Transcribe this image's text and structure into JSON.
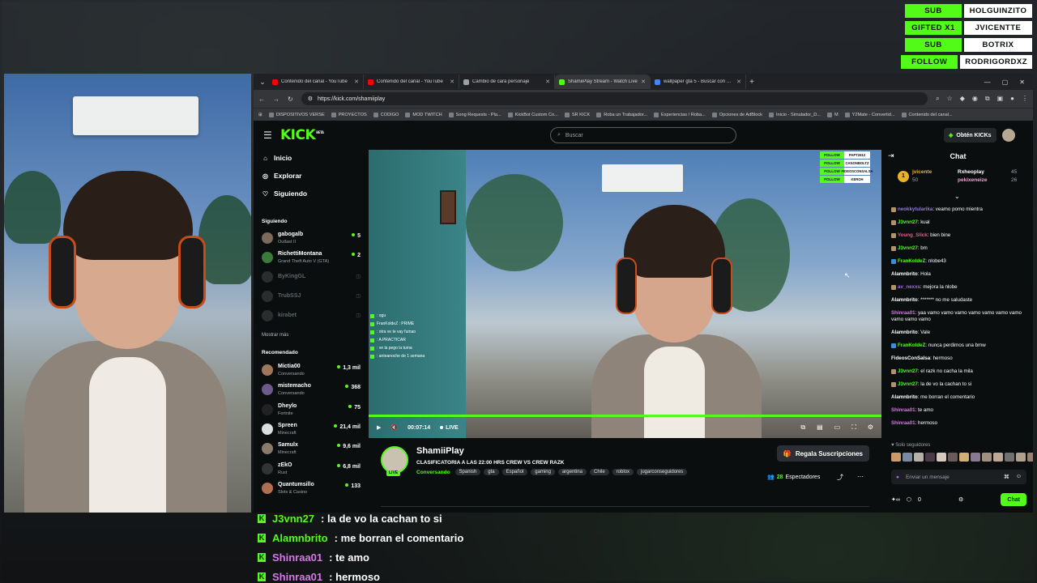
{
  "colors": {
    "kick_green": "#53fc18",
    "bg": "#0b0e0f",
    "panel": "#2b2f33"
  },
  "browser": {
    "tabs": [
      {
        "label": "Contenido del canal - YouTube",
        "icon_color": "#ff0000",
        "active": false
      },
      {
        "label": "Contenido del canal - YouTube",
        "icon_color": "#ff0000",
        "active": false
      },
      {
        "label": "Cambio de cara personaje",
        "icon_color": "#9aa0a6",
        "active": false
      },
      {
        "label": "ShamiiPlay Stream - Watch Live",
        "icon_color": "#53fc18",
        "active": true
      },
      {
        "label": "wallpaper gta 5 - Buscar con Google",
        "icon_color": "#4285f4",
        "active": false
      }
    ],
    "new_tab": "+",
    "url": "https://kick.com/shamiiplay",
    "bookmarks": [
      "DISPOSITIVOS VERSE",
      "PROYECTOS",
      "CODIGO",
      "MOD TWITCH",
      "Song Requests - Pla...",
      "KickBot Custom Co...",
      "SR KICK",
      "Roba un Trabajador...",
      "Experiencias / Roba...",
      "Opciones de AdBlock",
      "Inicio - Simulador_D...",
      "M",
      "Y2Mate - Convertid...",
      "Contenido del canal..."
    ]
  },
  "kick": {
    "logo": "KICK",
    "logo_sup": "BETA",
    "search_placeholder": "Buscar",
    "get_kicks": "Obtén KICKs",
    "nav": [
      {
        "label": "Inicio",
        "icon": "home-icon",
        "glyph": "⌂"
      },
      {
        "label": "Explorar",
        "icon": "compass-icon",
        "glyph": "◎"
      },
      {
        "label": "Siguiendo",
        "icon": "heart-icon",
        "glyph": "♡"
      }
    ],
    "following_heading": "Siguiendo",
    "following": [
      {
        "name": "gabogalb",
        "game": "Outlast II",
        "count": "5",
        "live": true,
        "color": "#7c6a5a"
      },
      {
        "name": "RichettiMontana",
        "game": "Grand Theft Auto V (GTA)",
        "count": "2",
        "live": true,
        "color": "#3a7a3a"
      },
      {
        "name": "ByKingGL",
        "game": "",
        "count": "",
        "live": false,
        "color": "#666"
      },
      {
        "name": "TrubSSJ",
        "game": "",
        "count": "",
        "live": false,
        "color": "#666"
      },
      {
        "name": "kirabet",
        "game": "",
        "count": "",
        "live": false,
        "color": "#666"
      }
    ],
    "show_more": "Mostrar más",
    "recommended_heading": "Recomendado",
    "recommended": [
      {
        "name": "Mictia00",
        "game": "Conversando",
        "count": "1,3 mil",
        "color": "#a0765a"
      },
      {
        "name": "mistemacho",
        "game": "Conversando",
        "count": "368",
        "color": "#6d5a8a"
      },
      {
        "name": "Dheylo",
        "game": "Fortnite",
        "count": "75",
        "color": "#222"
      },
      {
        "name": "Spreen",
        "game": "Minecraft",
        "count": "21,4 mil",
        "color": "#ddd"
      },
      {
        "name": "Samulx",
        "game": "Minecraft",
        "count": "9,6 mil",
        "color": "#8a7a6a"
      },
      {
        "name": "zEkO",
        "game": "Rust",
        "count": "6,8 mil",
        "color": "#333"
      },
      {
        "name": "Quantumsillo",
        "game": "Slots & Casino",
        "count": "133",
        "color": "#b07050"
      }
    ],
    "video": {
      "time": "00:07:14",
      "live": "LIVE",
      "progress": 1.0,
      "alerts": [
        {
          "type": "FOLLOW",
          "user": "PAPT2612"
        },
        {
          "type": "FOLLOW",
          "user": "CANONBOLTZ"
        },
        {
          "type": "FOLLOW",
          "user": "FIDEOSCONSALSA"
        },
        {
          "type": "FOLLOW",
          "user": "KEROH"
        }
      ],
      "overlay_chat": [
        ": ogu",
        "FranKoldeZ : PRIME",
        ": otra ve te vay fumao",
        ": A PRACTICAR",
        ": ve la pego la tuma",
        ": anteanoche de 1 semana"
      ]
    },
    "stream": {
      "name": "ShamiiPlay",
      "live_badge": "LIVE",
      "title": "CLASIFICATORIA A LAS 22:00 HRS CREW VS CREW RAZK",
      "category": "Conversando",
      "tags": [
        "Spanish",
        "gta",
        "Español",
        "gaming",
        "argentina",
        "Chile",
        "roblox",
        "jugarconseguidores"
      ],
      "sub_button": "Regala Suscripciones",
      "viewers": "28",
      "viewers_label": "Espectadores"
    },
    "chat": {
      "title": "Chat",
      "pinned": [
        {
          "user": "jvicente",
          "value": "50",
          "color": "#e8b32c"
        },
        {
          "user": "Rxheoplay",
          "value": "45",
          "color": "#ffffff"
        },
        {
          "user": "pekixeneize",
          "value": "26",
          "color": "#f0a0d0"
        }
      ],
      "pinned_rank": "1",
      "messages": [
        {
          "user": "neokkytularika",
          "text": "veamo pomo mientra",
          "color": "#8f7bd6",
          "badges": [
            "#b5936a"
          ]
        },
        {
          "user": "J3vnn27",
          "text": "kual",
          "color": "#53fc18",
          "badges": [
            "#b5936a"
          ]
        },
        {
          "user": "Young_Slick",
          "text": "bien bine",
          "color": "#e25a8a",
          "badges": [
            "#b5936a"
          ]
        },
        {
          "user": "J3vnn27",
          "text": "bm",
          "color": "#53fc18",
          "badges": [
            "#b5936a"
          ]
        },
        {
          "user": "FranKoldeZ",
          "text": "nlobe43",
          "color": "#53fc18",
          "badges": [
            "#3a8ed6"
          ]
        },
        {
          "user": "Alamnbrito",
          "text": "Hola",
          "color": "#ffffff",
          "badges": []
        },
        {
          "user": "av_nexxs",
          "text": "mejora la nlobe",
          "color": "#9a6ae8",
          "badges": [
            "#b5936a"
          ]
        },
        {
          "user": "Alamnbrito",
          "text": "******* no me saludaste",
          "color": "#ffffff",
          "badges": []
        },
        {
          "user": "Shinraa01",
          "text": "yaa vamo vamo vamo vamo vamo vamo vamo vamo vamo vamo",
          "color": "#d678e8",
          "badges": []
        },
        {
          "user": "Alamnbrito",
          "text": "Vale",
          "color": "#ffffff",
          "badges": []
        },
        {
          "user": "FranKoldeZ",
          "text": "nunca perdimos una bmw",
          "color": "#53fc18",
          "badges": [
            "#3a8ed6"
          ]
        },
        {
          "user": "FideosConSalsa",
          "text": "hermoso",
          "color": "#ffffff",
          "badges": []
        },
        {
          "user": "J3vnn27",
          "text": "el razk no cacha la mila",
          "color": "#53fc18",
          "badges": [
            "#b5936a"
          ]
        },
        {
          "user": "J3vnn27",
          "text": "la de vo la cachan to si",
          "color": "#53fc18",
          "badges": [
            "#b5936a"
          ]
        },
        {
          "user": "Alamnbrito",
          "text": "me borran el comentario",
          "color": "#ffffff",
          "badges": []
        },
        {
          "user": "Shinraa01",
          "text": "te amo",
          "color": "#d678e8",
          "badges": []
        },
        {
          "user": "Shinraa01",
          "text": "hermoso",
          "color": "#d678e8",
          "badges": []
        }
      ],
      "followers_only": "Solo seguidores",
      "input_placeholder": "Enviar un mensaje",
      "points": "0",
      "send": "Chat"
    }
  },
  "overlay_chat": [
    {
      "user": "J3vnn27",
      "text": ": la de vo la cachan to si",
      "color": "#53fc18"
    },
    {
      "user": "Alamnbrito",
      "text": ": me borran el comentario",
      "color": "#53fc18"
    },
    {
      "user": "Shinraa01",
      "text": ": te amo",
      "color": "#d678e8"
    },
    {
      "user": "Shinraa01",
      "text": ": hermoso",
      "color": "#d678e8"
    }
  ],
  "overlay_alerts": [
    {
      "type": "SUB",
      "user": "HOLGUINZITO"
    },
    {
      "type": "GIFTED X1",
      "user": "JVICENTTE"
    },
    {
      "type": "SUB",
      "user": "BOTRIX"
    },
    {
      "type": "FOLLOW",
      "user": "RODRIGORDXZ"
    }
  ]
}
